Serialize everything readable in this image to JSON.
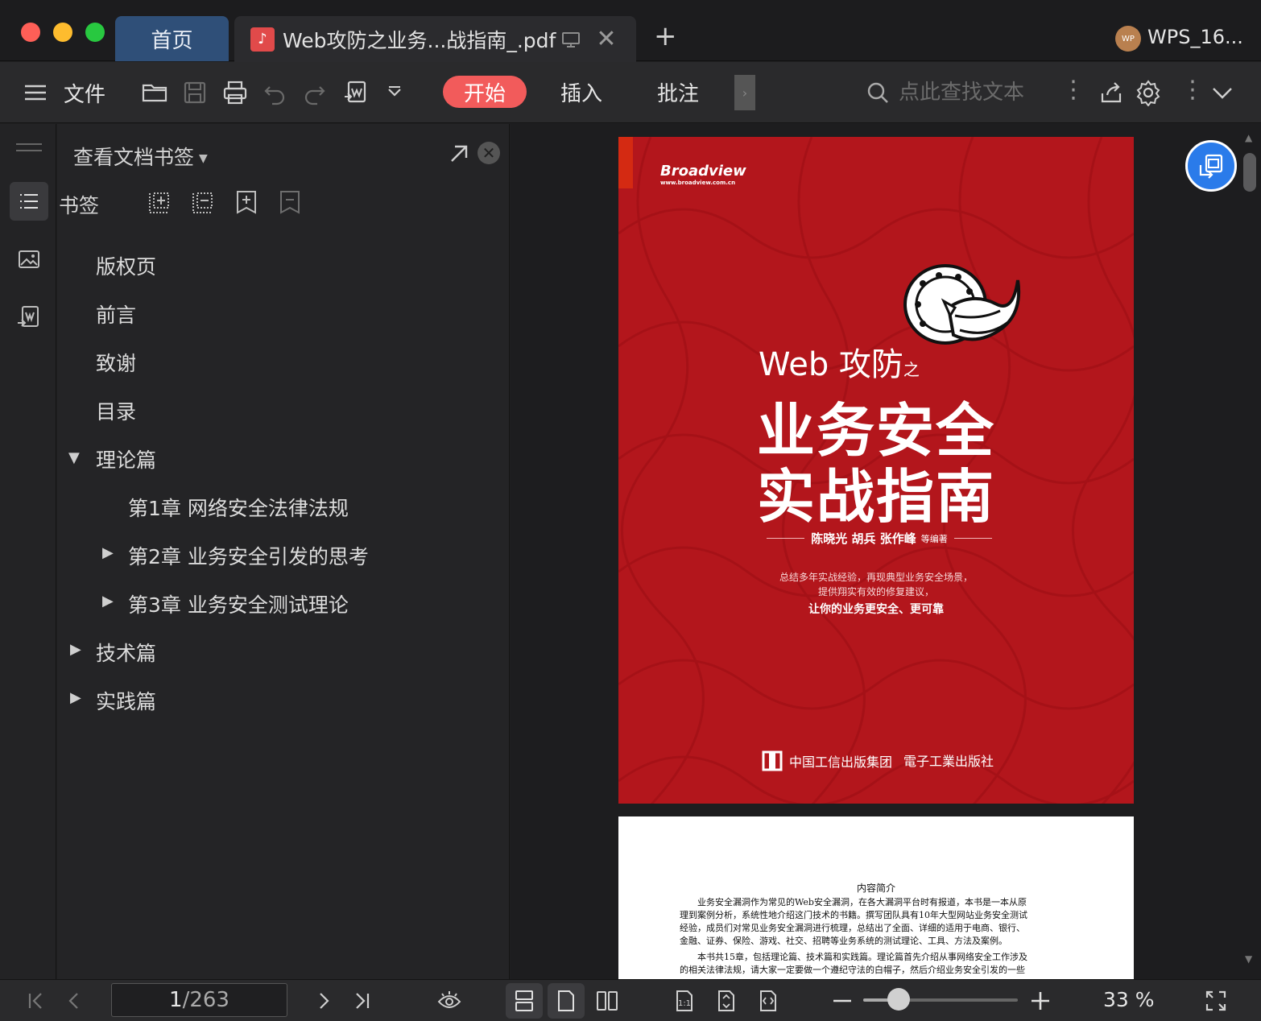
{
  "titlebar": {
    "tabs": [
      {
        "label": "首页"
      },
      {
        "label": "Web攻防之业务...战指南_.pdf"
      }
    ],
    "account_label": "WPS_16...",
    "avatar_text": "WP"
  },
  "toolbar": {
    "file_label": "文件",
    "ribbon_tabs": [
      {
        "label": "开始",
        "active": true
      },
      {
        "label": "插入",
        "active": false
      },
      {
        "label": "批注",
        "active": false
      }
    ],
    "search_placeholder": "点此查找文本"
  },
  "bookmark_panel": {
    "title": "查看文档书签",
    "section_label": "书签",
    "items": [
      {
        "label": "版权页",
        "level": 0,
        "expander": "none"
      },
      {
        "label": "前言",
        "level": 0,
        "expander": "none"
      },
      {
        "label": "致谢",
        "level": 0,
        "expander": "none"
      },
      {
        "label": "目录",
        "level": 0,
        "expander": "none"
      },
      {
        "label": "理论篇",
        "level": 0,
        "expander": "expanded"
      },
      {
        "label": "第1章  网络安全法律法规",
        "level": 1,
        "expander": "none"
      },
      {
        "label": "第2章  业务安全引发的思考",
        "level": 1,
        "expander": "collapsed"
      },
      {
        "label": "第3章  业务安全测试理论",
        "level": 1,
        "expander": "collapsed"
      },
      {
        "label": "技术篇",
        "level": 0,
        "expander": "collapsed"
      },
      {
        "label": "实践篇",
        "level": 0,
        "expander": "collapsed"
      }
    ]
  },
  "document": {
    "cover": {
      "publisher_brand": "Broadview",
      "publisher_url": "www.broadview.com.cn",
      "subtitle_main": "Web 攻防",
      "subtitle_small": "之",
      "title_line1": "业务安全",
      "title_line2": "实战指南",
      "authors": "陈晓光 胡兵 张作峰",
      "authors_suffix": "等编著",
      "tagline_1": "总结多年实战经验，再现典型业务安全场景，",
      "tagline_2": "提供翔实有效的修复建议，",
      "tagline_3": "让你的业务更安全、更可靠",
      "footer_left": "中国工信出版集团",
      "footer_right": "電子工業出版社"
    },
    "page2": {
      "heading": "内容简介",
      "lines": [
        "　　业务安全漏洞作为常见的Web安全漏洞，在各大漏洞平台时有报道，本书是一本从原",
        "理到案例分析，系统性地介绍这门技术的书籍。撰写团队具有10年大型网站业务安全测试",
        "经验，成员们对常见业务安全漏洞进行梳理，总结出了全面、详细的适用于电商、银行、",
        "金融、证券、保险、游戏、社交、招聘等业务系统的测试理论、工具、方法及案例。",
        "　　本书共15章，包括理论篇、技术篇和实践篇。理论篇首先介绍从事网络安全工作涉及",
        "的相关法律法规，请大家一定要做一个遵纪守法的白帽子，然后介绍业务安全引发的一些"
      ]
    }
  },
  "statusbar": {
    "current_page": "1",
    "total_pages": "/263",
    "zoom_label": "33 %",
    "zoom_fraction": 0.23
  },
  "colors": {
    "accent": "#f25b5b",
    "home_tab": "#2f4f78",
    "cover_red": "#b3161c",
    "float_button": "#2a7bea"
  }
}
